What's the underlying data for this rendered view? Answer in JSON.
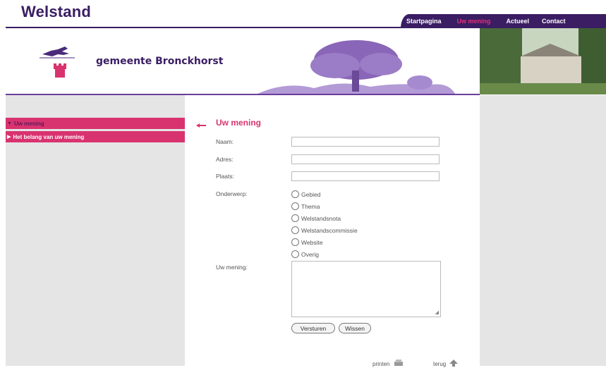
{
  "site_title": "Welstand",
  "nav": {
    "items": [
      {
        "label": "Startpagina"
      },
      {
        "label": "Uw mening"
      },
      {
        "label": "Actueel"
      },
      {
        "label": "Contact"
      }
    ]
  },
  "banner": {
    "municipality": "gemeente Bronckhorst"
  },
  "sidebar": {
    "items": [
      {
        "label": "Uw mening"
      },
      {
        "label": "Het belang van uw mening"
      }
    ]
  },
  "form": {
    "heading": "Uw mening",
    "name_label": "Naam:",
    "address_label": "Adres:",
    "place_label": "Plaats:",
    "subject_label": "Onderwerp:",
    "subject_options": [
      "Gebied",
      "Thema",
      "Welstandsnota",
      "Welstandscommissie",
      "Website",
      "Overig"
    ],
    "opinion_label": "Uw mening:",
    "submit_label": "Versturen",
    "reset_label": "Wissen"
  },
  "footer": {
    "print_label": "printen",
    "back_label": "terug"
  },
  "colors": {
    "brand_purple": "#3a1d63",
    "accent_pink": "#d9336f"
  }
}
